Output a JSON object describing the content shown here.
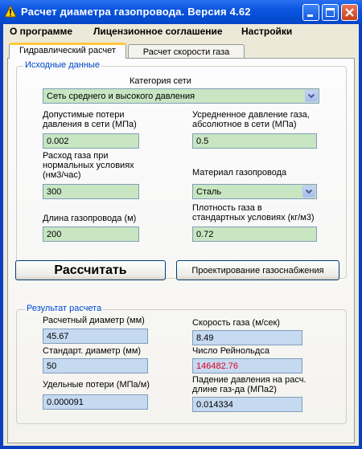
{
  "window": {
    "title": "Расчет диаметра газопровода. Версия 4.62",
    "icons": {
      "app": "warning-triangle-icon",
      "minimize": "minimize-icon",
      "maximize": "maximize-icon",
      "close": "close-icon"
    },
    "colors": {
      "titlebar": "#0a55e0",
      "close": "#c6401d"
    }
  },
  "menu": {
    "items": [
      "О программе",
      "Лицензионное соглашение",
      "Настройки"
    ]
  },
  "tabs": [
    {
      "label": "Гидравлический расчет",
      "active": true
    },
    {
      "label": "Расчет скорости газа",
      "active": false
    }
  ],
  "input_group": {
    "title": "Исходные данные",
    "network_category": {
      "label": "Категория сети",
      "value": "Сеть среднего и высокого давления"
    },
    "allowed_losses": {
      "label_1": "Допустимые потери",
      "label_2": "давления в сети (МПа)",
      "value": "0.002"
    },
    "avg_pressure": {
      "label_1": "Усредненное давление газа,",
      "label_2": "абсолютное в сети (МПа)",
      "value": "0.5"
    },
    "gas_flow": {
      "label_1": "Расход газа при",
      "label_2": "нормальных условиях",
      "label_3": "(нм3/час)",
      "value": "300"
    },
    "pipe_material": {
      "label": "Материал газопровода",
      "value": "Сталь"
    },
    "pipe_length": {
      "label": "Длина газопровода (м)",
      "value": "200"
    },
    "gas_density": {
      "label_1": "Плотность газа в",
      "label_2": "стандартных условиях (кг/м3)",
      "value": "0.72"
    }
  },
  "buttons": {
    "calculate": "Рассчитать",
    "design": "Проектирование газоснабжения"
  },
  "result_group": {
    "title": "Результат расчета",
    "calc_diameter": {
      "label": "Расчетный диаметр (мм)",
      "value": "45.67"
    },
    "gas_speed": {
      "label": "Скорость газа (м/сек)",
      "value": "8.49"
    },
    "std_diameter": {
      "label": "Стандарт. диаметр (мм)",
      "value": "50"
    },
    "reynolds": {
      "label": "Число Рейнольдса",
      "value": "146482.76",
      "value_color": "#e0001a"
    },
    "specific_losses": {
      "label": "Удельные потери (МПа/м)",
      "value": "0.000091"
    },
    "pressure_drop": {
      "label_1": "Падение давления на расч.",
      "label_2": "длине газ-да (МПа2)",
      "value": "0.014334"
    }
  }
}
